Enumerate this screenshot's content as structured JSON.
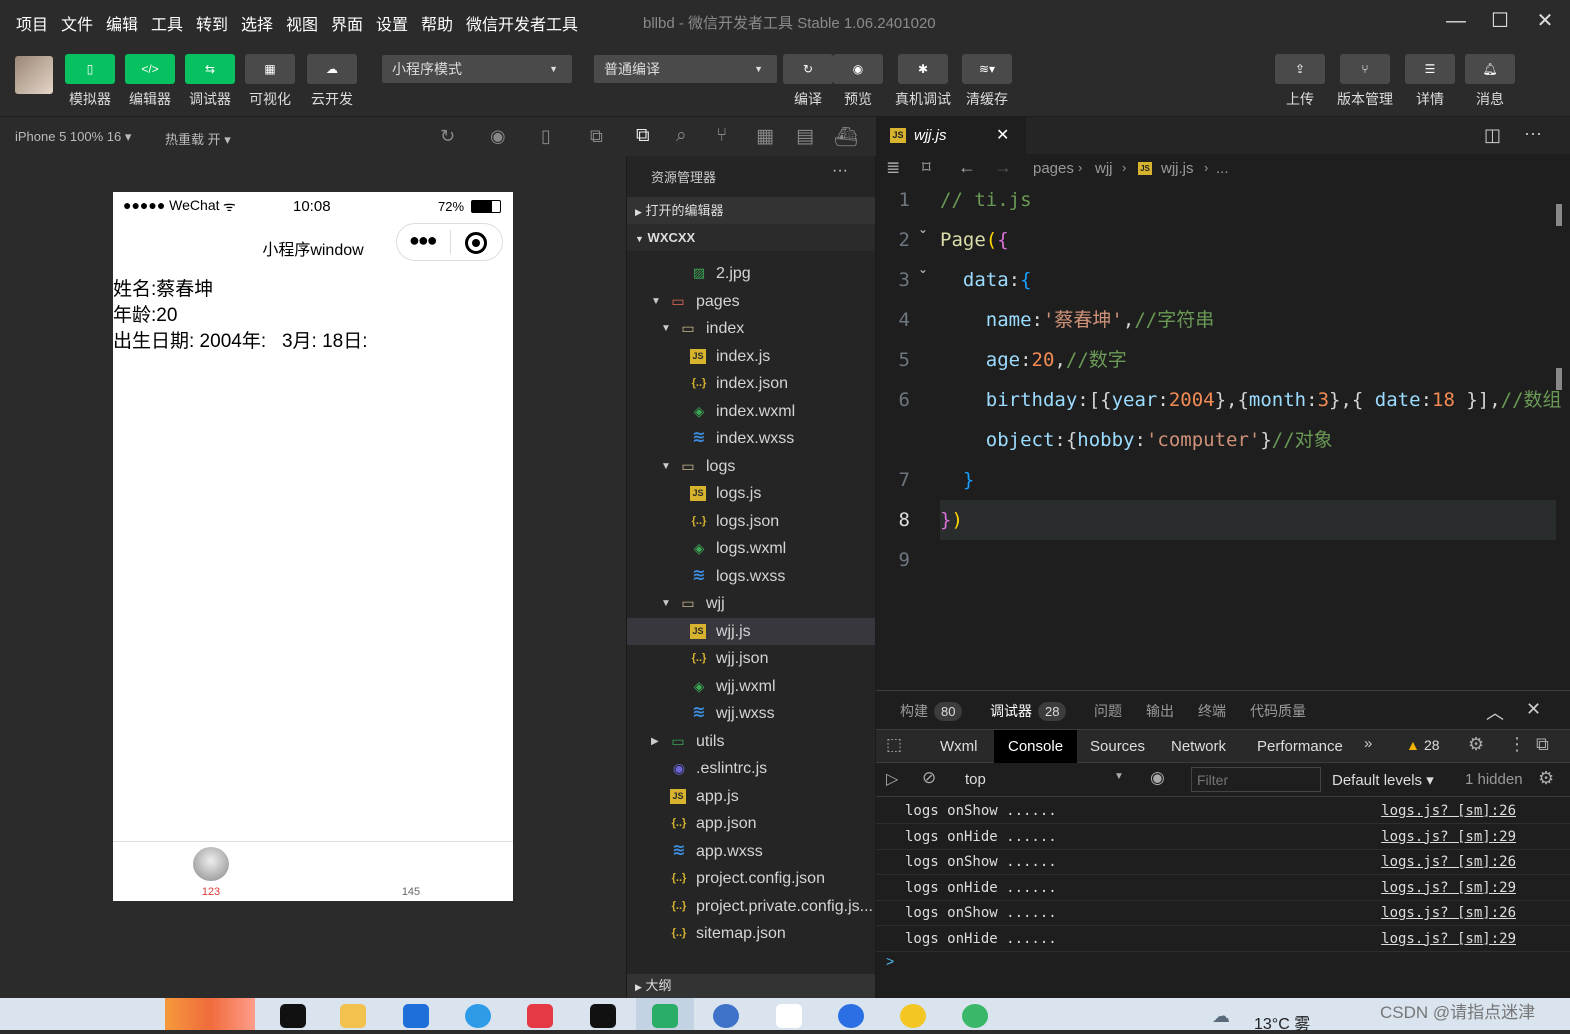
{
  "menu": {
    "items": [
      "项目",
      "文件",
      "编辑",
      "工具",
      "转到",
      "选择",
      "视图",
      "界面",
      "设置",
      "帮助",
      "微信开发者工具"
    ],
    "window_title": "bllbd - 微信开发者工具 Stable 1.06.2401020"
  },
  "toolbar": {
    "simulator": "模拟器",
    "editor": "编辑器",
    "debugger": "调试器",
    "visual": "可视化",
    "cloud": "云开发",
    "mode": "小程序模式",
    "compile_mode": "普通编译",
    "compile": "编译",
    "preview": "预览",
    "real_debug": "真机调试",
    "clear_cache": "清缓存",
    "upload": "上传",
    "version": "版本管理",
    "details": "详情",
    "messages": "消息"
  },
  "sim_bar": {
    "device": "iPhone 5 100% 16",
    "hot_reload": "热重载 开"
  },
  "phone": {
    "signal": "●●●●● WeChat",
    "time": "10:08",
    "battery": "72%",
    "nav_title": "小程序window",
    "line1": "姓名:蔡春坤",
    "line2": "年龄:20",
    "line3": "出生日期: 2004年:   3月: 18日:",
    "tab1": "123",
    "tab2": "145"
  },
  "explorer": {
    "title": "资源管理器",
    "open_editors": "打开的编辑器",
    "project": "WXCXX",
    "outline": "大纲",
    "files": [
      {
        "name": "2.jpg",
        "type": "img",
        "depth": 3
      },
      {
        "name": "pages",
        "type": "folder",
        "depth": 1,
        "open": true
      },
      {
        "name": "index",
        "type": "folder",
        "depth": 2,
        "open": true
      },
      {
        "name": "index.js",
        "type": "js",
        "depth": 3
      },
      {
        "name": "index.json",
        "type": "json",
        "depth": 3
      },
      {
        "name": "index.wxml",
        "type": "wxml",
        "depth": 3
      },
      {
        "name": "index.wxss",
        "type": "wxss",
        "depth": 3
      },
      {
        "name": "logs",
        "type": "folder",
        "depth": 2,
        "open": true
      },
      {
        "name": "logs.js",
        "type": "js",
        "depth": 3
      },
      {
        "name": "logs.json",
        "type": "json",
        "depth": 3
      },
      {
        "name": "logs.wxml",
        "type": "wxml",
        "depth": 3
      },
      {
        "name": "logs.wxss",
        "type": "wxss",
        "depth": 3
      },
      {
        "name": "wjj",
        "type": "folder",
        "depth": 2,
        "open": true
      },
      {
        "name": "wjj.js",
        "type": "js",
        "depth": 3,
        "selected": true
      },
      {
        "name": "wjj.json",
        "type": "json",
        "depth": 3
      },
      {
        "name": "wjj.wxml",
        "type": "wxml",
        "depth": 3
      },
      {
        "name": "wjj.wxss",
        "type": "wxss",
        "depth": 3
      },
      {
        "name": "utils",
        "type": "folder",
        "depth": 1,
        "open": false
      },
      {
        "name": ".eslintrc.js",
        "type": "eslint",
        "depth": 1
      },
      {
        "name": "app.js",
        "type": "js",
        "depth": 1
      },
      {
        "name": "app.json",
        "type": "json",
        "depth": 1
      },
      {
        "name": "app.wxss",
        "type": "wxss",
        "depth": 1
      },
      {
        "name": "project.config.json",
        "type": "json",
        "depth": 1
      },
      {
        "name": "project.private.config.js...",
        "type": "json",
        "depth": 1
      },
      {
        "name": "sitemap.json",
        "type": "json",
        "depth": 1
      }
    ]
  },
  "editor": {
    "tab": "wjj.js",
    "breadcrumb": [
      "pages",
      "wjj",
      "wjj.js",
      "..."
    ],
    "lines": [
      {
        "n": "1",
        "html": "<span style='color:#6a9955'>// ti.js</span>"
      },
      {
        "n": "2",
        "html": "<span style='color:#dcdcaa'>Page</span><span style='color:#ffd700'>(</span><span style='color:#da70d6'>{</span>"
      },
      {
        "n": "3",
        "html": "  <span style='color:#9cdcfe'>data</span><span style='color:#d4d4d4'>:</span><span style='color:#179fff'>{</span>"
      },
      {
        "n": "4",
        "html": "    <span style='color:#9cdcfe'>name</span><span style='color:#d4d4d4'>:</span><span style='color:#ce9178'>'蔡春坤'</span><span style='color:#d4d4d4'>,</span><span style='color:#6a9955'>//字符串</span>"
      },
      {
        "n": "5",
        "html": "    <span style='color:#9cdcfe'>age</span><span style='color:#d4d4d4'>:</span><span style='color:#f28b54'>20</span><span style='color:#d4d4d4'>,</span><span style='color:#6a9955'>//数字</span>"
      },
      {
        "n": "6",
        "html": "    <span style='color:#9cdcfe'>birthday</span><span style='color:#d4d4d4'>:[{</span><span style='color:#9cdcfe'>year</span><span style='color:#d4d4d4'>:</span><span style='color:#f28b54'>2004</span><span style='color:#d4d4d4'>},{</span><span style='color:#9cdcfe'>month</span><span style='color:#d4d4d4'>:</span><span style='color:#f28b54'>3</span><span style='color:#d4d4d4'>},{ </span><span style='color:#9cdcfe'>date</span><span style='color:#d4d4d4'>:</span><span style='color:#f28b54'>18</span><span style='color:#d4d4d4'> }],</span><span style='color:#6a9955'>//数组</span>"
      },
      {
        "n": "",
        "html": "    <span style='color:#9cdcfe'>object</span><span style='color:#d4d4d4'>:{</span><span style='color:#9cdcfe'>hobby</span><span style='color:#d4d4d4'>:</span><span style='color:#ce9178'>'computer'</span><span style='color:#d4d4d4'>}</span><span style='color:#6a9955'>//对象</span>"
      },
      {
        "n": "7",
        "html": "  <span style='color:#179fff'>}</span>"
      },
      {
        "n": "8",
        "html": "<span style='color:#da70d6'>}</span><span style='color:#ffd700'>)</span>"
      },
      {
        "n": "9",
        "html": ""
      }
    ]
  },
  "devtools": {
    "tabs": [
      {
        "label": "构建",
        "badge": "80"
      },
      {
        "label": "调试器",
        "badge": "28"
      },
      {
        "label": "问题",
        "badge": ""
      },
      {
        "label": "输出",
        "badge": ""
      },
      {
        "label": "终端",
        "badge": ""
      },
      {
        "label": "代码质量",
        "badge": ""
      }
    ],
    "panels": [
      "Wxml",
      "Console",
      "Sources",
      "Network",
      "Performance"
    ],
    "warnings": "28",
    "context": "top",
    "filter_placeholder": "Filter",
    "levels": "Default levels",
    "hidden": "1 hidden",
    "logs": [
      {
        "msg": "logs onShow ......",
        "src": "logs.js? [sm]:26"
      },
      {
        "msg": "logs onHide ......",
        "src": "logs.js? [sm]:29"
      },
      {
        "msg": "logs onShow ......",
        "src": "logs.js? [sm]:26"
      },
      {
        "msg": "logs onHide ......",
        "src": "logs.js? [sm]:29"
      },
      {
        "msg": "logs onShow ......",
        "src": "logs.js? [sm]:26"
      },
      {
        "msg": "logs onHide ......",
        "src": "logs.js? [sm]:29"
      }
    ],
    "prompt": ">"
  },
  "taskbar": {
    "weather": "13°C 雾",
    "watermark": "CSDN @请指点迷津"
  }
}
